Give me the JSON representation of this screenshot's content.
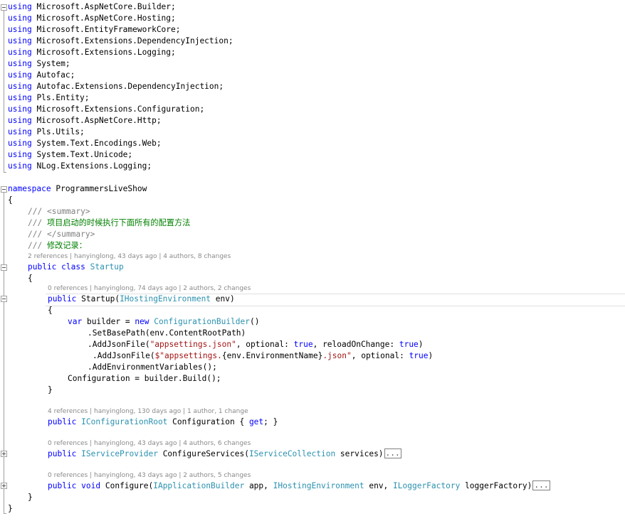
{
  "usings": [
    {
      "keyword": "using",
      "ns": "Microsoft.AspNetCore.Builder;"
    },
    {
      "keyword": "using",
      "ns": "Microsoft.AspNetCore.Hosting;"
    },
    {
      "keyword": "using",
      "ns": "Microsoft.EntityFrameworkCore;"
    },
    {
      "keyword": "using",
      "ns": "Microsoft.Extensions.DependencyInjection;"
    },
    {
      "keyword": "using",
      "ns": "Microsoft.Extensions.Logging;"
    },
    {
      "keyword": "using",
      "ns": "System;"
    },
    {
      "keyword": "using",
      "ns": "Autofac;"
    },
    {
      "keyword": "using",
      "ns": "Autofac.Extensions.DependencyInjection;"
    },
    {
      "keyword": "using",
      "ns": "Pls.Entity;"
    },
    {
      "keyword": "using",
      "ns": "Microsoft.Extensions.Configuration;"
    },
    {
      "keyword": "using",
      "ns": "Microsoft.AspNetCore.Http;"
    },
    {
      "keyword": "using",
      "ns": "Pls.Utils;"
    },
    {
      "keyword": "using",
      "ns": "System.Text.Encodings.Web;"
    },
    {
      "keyword": "using",
      "ns": "System.Text.Unicode;"
    },
    {
      "keyword": "using",
      "ns": "NLog.Extensions.Logging;"
    }
  ],
  "namespace_decl": {
    "keyword": "namespace",
    "name": "ProgrammersLiveShow"
  },
  "braces": {
    "open": "{",
    "close": "}"
  },
  "doc_comment": {
    "prefix": "///",
    "summary_open": "<summary>",
    "summary_text": "项目启动的时候执行下面所有的配置方法",
    "summary_close": "</summary>",
    "extra_line": "修改记录："
  },
  "class_lens": "2 references | hanyinglong, 43 days ago | 4 authors, 8 changes",
  "class_decl": {
    "kw1": "public",
    "kw2": "class",
    "name": "Startup"
  },
  "ctor_lens": "0 references | hanyinglong, 74 days ago | 2 authors, 2 changes",
  "ctor": {
    "kw": "public",
    "name": "Startup(",
    "param_type": "IHostingEnvironment",
    "param_name": " env)",
    "body": {
      "var_kw": "var",
      "var_name": " builder = ",
      "new_kw": "new",
      "type": "ConfigurationBuilder",
      "type_suffix": "()",
      "set_base_path": ".SetBasePath(env.ContentRootPath)",
      "add_json_1": {
        "call": ".AddJsonFile(",
        "file": "\"appsettings.json\"",
        "mid": ", optional: ",
        "val1": "true",
        "mid2": ", reloadOnChange: ",
        "val2": "true",
        "end": ")"
      },
      "add_json_2": {
        "call": ".AddJsonFile(",
        "file_start": "$\"appsettings.",
        "interp": "{env.EnvironmentName}",
        "file_end": ".json\"",
        "mid": ", optional: ",
        "val": "true",
        "end": ")"
      },
      "add_env": ".AddEnvironmentVariables();",
      "assign": "Configuration = builder.Build();"
    }
  },
  "config_lens": "4 references | hanyinglong, 130 days ago | 1 author, 1 change",
  "config_prop": {
    "kw": "public",
    "type": "IConfigurationRoot",
    "name": " Configuration { ",
    "get_kw": "get",
    "end": "; }"
  },
  "configure_services_lens": "0 references | hanyinglong, 43 days ago | 4 authors, 6 changes",
  "configure_services": {
    "kw": "public",
    "ret_type": "IServiceProvider",
    "name": " ConfigureServices(",
    "param_type": "IServiceCollection",
    "param_name": " services)",
    "collapsed": "..."
  },
  "configure_lens": "0 references | hanyinglong, 43 days ago | 2 authors, 5 changes",
  "configure": {
    "kw1": "public",
    "kw2": "void",
    "name": " Configure(",
    "p1_type": "IApplicationBuilder",
    "p1_name": " app, ",
    "p2_type": "IHostingEnvironment",
    "p2_name": " env, ",
    "p3_type": "ILoggerFactory",
    "p3_name": " loggerFactory)",
    "collapsed": "..."
  }
}
